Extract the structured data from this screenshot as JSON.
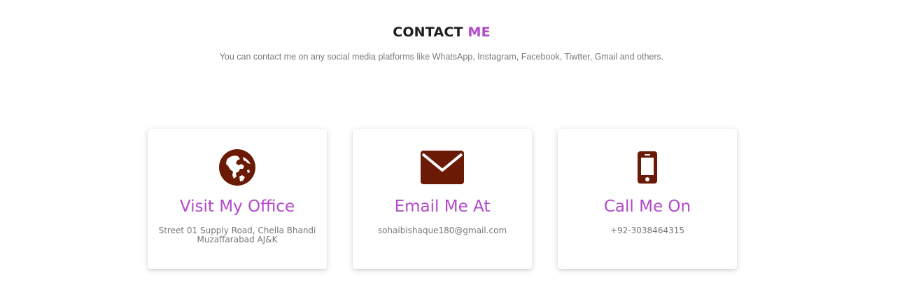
{
  "header": {
    "title_main": "CONTACT",
    "title_accent": "ME",
    "subtitle": "You can contact me on any social media platforms like WhatsApp, Instagram, Facebook, Tiwtter, Gmail and others."
  },
  "cards": [
    {
      "icon": "globe-icon",
      "title": "Visit My Office",
      "detail_line1": "Street 01 Supply Road, Chella Bhandi",
      "detail_line2": "Muzaffarabad AJ&K"
    },
    {
      "icon": "envelope-icon",
      "title": "Email Me At",
      "detail_line1": "sohaibishaque180@gmail.com",
      "detail_line2": ""
    },
    {
      "icon": "mobile-phone-icon",
      "title": "Call Me On",
      "detail_line1": "+92-3038464315",
      "detail_line2": ""
    }
  ],
  "colors": {
    "accent": "#b24ac9",
    "icon": "#6b1a06",
    "heading": "#1f1f1f",
    "text": "#777777"
  }
}
